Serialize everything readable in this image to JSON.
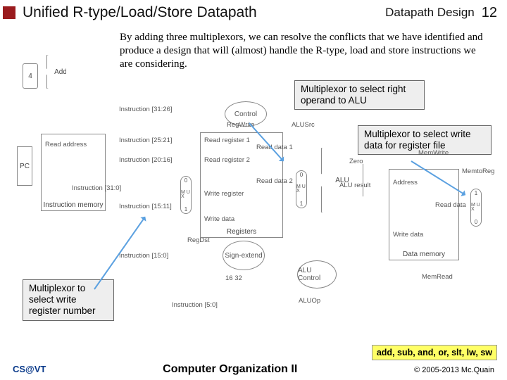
{
  "header": {
    "title": "Unified R-type/Load/Store Datapath",
    "topic": "Datapath Design",
    "page": "12"
  },
  "body_text": "By adding three multiplexors, we can resolve the conflicts that we have identified and produce a design that will (almost) handle the R-type, load and store instructions we are considering.",
  "callouts": {
    "right_operand": "Multiplexor to select right operand to ALU",
    "write_data": "Multiplexor to select write data for register file",
    "write_reg": "Multiplexor to select write register number"
  },
  "diagram": {
    "pc": "PC",
    "add": "Add",
    "four": "4",
    "instr_mem": "Instruction memory",
    "read_addr": "Read address",
    "instr_out": "Instruction [31:0]",
    "control": "Control",
    "instr_31_26": "Instruction [31:26]",
    "instr_25_21": "Instruction [25:21]",
    "instr_20_16": "Instruction [20:16]",
    "instr_15_11": "Instruction [15:11]",
    "instr_15_0": "Instruction [15:0]",
    "instr_5_0": "Instruction [5:0]",
    "regdst": "RegDst",
    "regwrite": "RegWrite",
    "alusrc": "ALUSrc",
    "memwrite": "MemWrite",
    "memread": "MemRead",
    "memtoreg": "MemtoReg",
    "aluop": "ALUOp",
    "read_reg1": "Read register 1",
    "read_reg2": "Read register 2",
    "write_reg": "Write register",
    "write_data": "Write data",
    "read_data1": "Read data 1",
    "read_data2": "Read data 2",
    "registers": "Registers",
    "sign_ext": "Sign-extend",
    "sign_ext_width": "16  32",
    "alu": "ALU",
    "alu_result": "ALU result",
    "alu_control": "ALU Control",
    "zero": "Zero",
    "address": "Address",
    "dm_write_data": "Write data",
    "data_mem": "Data memory",
    "read_data": "Read data",
    "mux": "M U X",
    "mux0": "0",
    "mux1": "1"
  },
  "yellow_bar": "add, sub, and, or, slt, lw, sw",
  "footer": {
    "left": "CS@VT",
    "center": "Computer Organization II",
    "right": "© 2005-2013 Mc.Quain"
  }
}
